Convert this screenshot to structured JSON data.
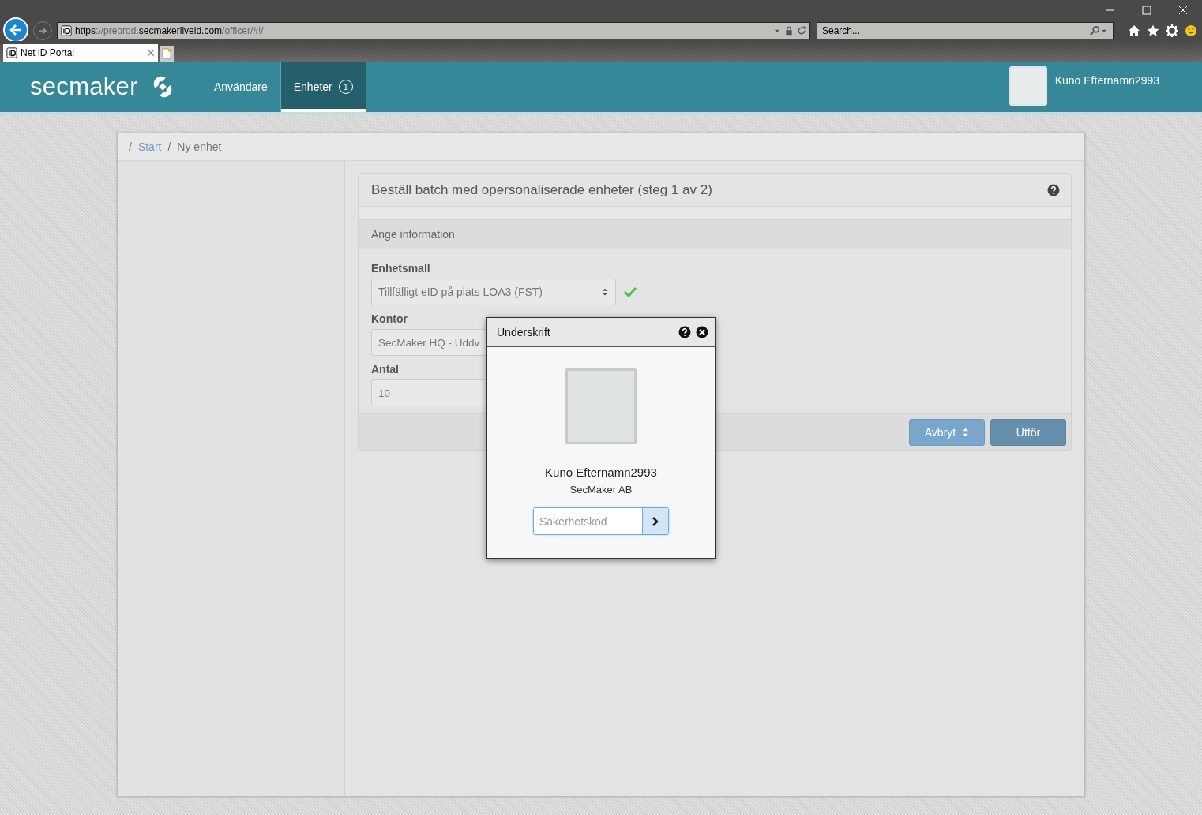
{
  "browser": {
    "url_parts": [
      {
        "text": "https",
        "dim": false
      },
      {
        "text": "://preprod.",
        "dim": true
      },
      {
        "text": "secmakerliveid.com",
        "dim": false
      },
      {
        "text": "/officer/#!/",
        "dim": true
      }
    ],
    "search": {
      "placeholder": "Search..."
    },
    "tabs": [
      {
        "title": "Net iD Portal",
        "selected": true
      }
    ]
  },
  "header": {
    "logo": "secmaker",
    "nav": [
      {
        "label": "Användare",
        "selected": false
      },
      {
        "label": "Enheter",
        "selected": true,
        "badge": "1"
      }
    ],
    "user": {
      "name": "Kuno Efternamn2993"
    }
  },
  "breadcrumb": [
    {
      "separator": "/",
      "label": "Start",
      "kind": "link"
    },
    {
      "separator": "/",
      "label": "Ny enhet",
      "kind": "current"
    }
  ],
  "card": {
    "title": "Beställ batch med opersonaliserade enheter (steg 1 av 2)",
    "section": "Ange information",
    "fields": [
      {
        "label": "Enhetsmall",
        "kind": "select",
        "value": "Tillfälligt eID på plats LOA3 (FST)",
        "valid": true
      },
      {
        "label": "Kontor",
        "kind": "text",
        "value": "SecMaker HQ - Uddv"
      },
      {
        "label": "Antal",
        "kind": "text",
        "value": "10"
      }
    ],
    "buttons": [
      {
        "label": "Avbryt",
        "kind": "dropdown"
      },
      {
        "label": "Utför",
        "kind": "primary"
      }
    ]
  },
  "modal": {
    "title": "Underskrift",
    "name": "Kuno Efternamn2993",
    "organization": "SecMaker AB",
    "input": {
      "placeholder": "Säkerhetskod"
    }
  }
}
